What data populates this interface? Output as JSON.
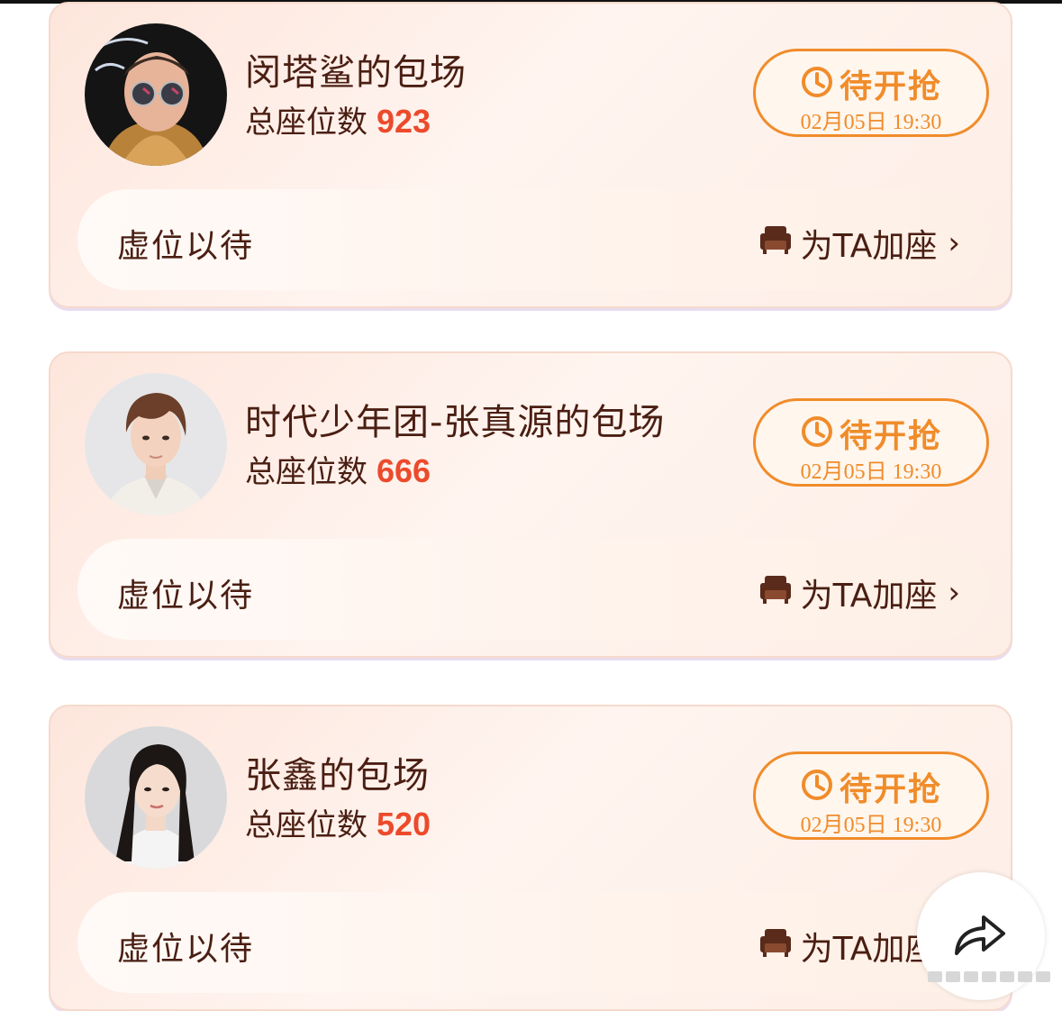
{
  "cards": [
    {
      "title": "闵塔鲨的包场",
      "seats_label": "总座位数",
      "seats_value": "923",
      "grab_label": "待开抢",
      "grab_time": "02月05日 19:30",
      "slot_text": "虚位以待",
      "add_seat_label": "为TA加座"
    },
    {
      "title": "时代少年团-张真源的包场",
      "seats_label": "总座位数",
      "seats_value": "666",
      "grab_label": "待开抢",
      "grab_time": "02月05日 19:30",
      "slot_text": "虚位以待",
      "add_seat_label": "为TA加座"
    },
    {
      "title": "张鑫的包场",
      "seats_label": "总座位数",
      "seats_value": "520",
      "grab_label": "待开抢",
      "grab_time": "02月05日 19:30",
      "slot_text": "虚位以待",
      "add_seat_label": "为TA加座"
    }
  ],
  "icons": {
    "clock": "clock-icon",
    "sofa": "sofa-icon",
    "chevron": "chevron-right-icon",
    "share": "share-arrow-icon"
  },
  "colors": {
    "accent_orange": "#f08c2a",
    "seat_number_red": "#ec4a2c",
    "text_brown": "#4a1e12",
    "card_bg": "#fde6dc"
  }
}
